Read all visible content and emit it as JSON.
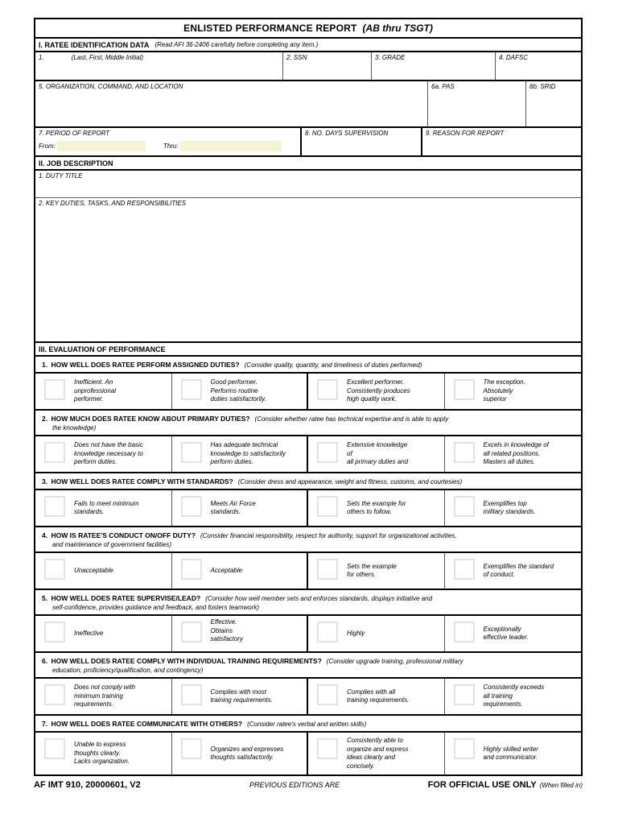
{
  "form": {
    "title_main": "ENLISTED PERFORMANCE REPORT",
    "title_sub": "(AB thru TSGT)"
  },
  "section_i": {
    "heading": "I. RATEE IDENTIFICATION DATA",
    "note": "(Read AFI 36-2406 carefully before completing any item.)",
    "fields": {
      "name_num": "1.",
      "name_label": "(Last, First, Middle Initial)",
      "ssn": "2.  SSN",
      "grade": "3.  GRADE",
      "dafsc": "4.  DAFSC",
      "organization": "5. ORGANIZATION, COMMAND, AND LOCATION",
      "pas": "6a. PAS",
      "srid": "6b. SRID",
      "period": "7.  PERIOD OF REPORT",
      "period_from": "From:",
      "period_thru": "Thru:",
      "period_from_value": "",
      "period_thru_value": "",
      "days_supervision": "8.  NO. DAYS SUPERVISION",
      "reason": "9.  REASON FOR REPORT"
    }
  },
  "section_ii": {
    "heading": "II.  JOB DESCRIPTION",
    "duty_title": "1.  DUTY TITLE",
    "key_duties": "2.  KEY DUTIES, TASKS, AND RESPONSIBILITIES"
  },
  "section_iii": {
    "heading": "III.  EVALUATION OF PERFORMANCE",
    "questions": [
      {
        "number": "1.",
        "text": "HOW WELL DOES RATEE PERFORM ASSIGNED DUTIES?",
        "hint": "(Consider quality, quantity, and timeliness of duties performed)",
        "cont": "",
        "cont_bold": "",
        "options": [
          {
            "lines": [
              "Inefficient. An",
              "unprofessional",
              "performer."
            ],
            "align": "center"
          },
          {
            "lines": [
              "Good performer.",
              "Performs routine",
              "duties satisfactorily."
            ],
            "align": "center"
          },
          {
            "lines": [
              "Excellent performer.",
              "Consistently produces",
              "high quality work."
            ],
            "align": "center"
          },
          {
            "lines": [
              "The exception.",
              "Absolutely",
              "superior"
            ],
            "align": "center"
          }
        ]
      },
      {
        "number": "2.",
        "text": "HOW MUCH DOES RATEE KNOW ABOUT PRIMARY DUTIES?",
        "hint": "(Consider whether ratee has technical expertise and is able to apply",
        "cont": "the knowledge)",
        "cont_bold": "",
        "options": [
          {
            "lines": [
              "Does not have the basic",
              "knowledge necessary to",
              "perform duties."
            ],
            "align": "center"
          },
          {
            "lines": [
              "Has adequate technical",
              "knowledge to satisfactorily",
              "perform duties."
            ],
            "align": "center"
          },
          {
            "lines": [
              "Extensive knowledge",
              "of",
              "all primary duties and"
            ],
            "align": "center"
          },
          {
            "lines": [
              "Excels in knowledge of",
              "all related positions.",
              "Masters all duties."
            ],
            "align": "center"
          }
        ]
      },
      {
        "number": "3.",
        "text": "HOW WELL DOES RATEE COMPLY WITH STANDARDS?",
        "hint": "(Consider dress and appearance, weight and fitness, customs, and courtesies)",
        "cont": "",
        "cont_bold": "",
        "options": [
          {
            "lines": [
              "Fails to meet minimum",
              "standards."
            ],
            "align": "center"
          },
          {
            "lines": [
              "Meets Air Force",
              "standards."
            ],
            "align": "center"
          },
          {
            "lines": [
              "Sets the example for",
              "others to follow."
            ],
            "align": "center"
          },
          {
            "lines": [
              "Exemplifies top",
              "military standards."
            ],
            "align": "center"
          }
        ]
      },
      {
        "number": "4.",
        "text": "HOW IS RATEE'S CONDUCT ON/OFF DUTY?",
        "hint": "(Consider financial responsibility, respect for authority, support for organizational activities,",
        "cont": "and maintenance of government facilities)",
        "cont_bold": "",
        "options": [
          {
            "lines": [
              "Unacceptable"
            ],
            "align": "center"
          },
          {
            "lines": [
              "Acceptable"
            ],
            "align": "center"
          },
          {
            "lines": [
              "Sets the example",
              "for others."
            ],
            "align": "center"
          },
          {
            "lines": [
              "Exemplifies the standard",
              "of conduct."
            ],
            "align": "center"
          }
        ]
      },
      {
        "number": "5.",
        "text": "HOW WELL DOES RATEE SUPERVISE/LEAD?",
        "hint": "(Consider how well member sets and enforces standards, displays initiative and",
        "cont": "self-confidence, provides guidance and feedback, and fosters teamwork)",
        "cont_bold": "",
        "options": [
          {
            "lines": [
              "Ineffective"
            ],
            "align": "center"
          },
          {
            "lines": [
              "Effective.",
              "Obtains",
              "satisfactory"
            ],
            "align": "top"
          },
          {
            "lines": [
              "Highly"
            ],
            "align": "center"
          },
          {
            "lines": [
              "Exceptionally",
              "effective leader."
            ],
            "align": "center"
          }
        ]
      },
      {
        "number": "6.",
        "text": "HOW WELL DOES RATEE COMPLY WITH INDIVIDUAL TRAINING REQUIREMENTS?",
        "hint": "(Consider upgrade training, professional military",
        "cont": "education, proficiency/qualification, and contingency)",
        "cont_bold": "",
        "options": [
          {
            "lines": [
              "Does not comply with",
              "minimum training",
              "requirements."
            ],
            "align": "center"
          },
          {
            "lines": [
              "Complies with most",
              "training requirements."
            ],
            "align": "center"
          },
          {
            "lines": [
              "Complies with all",
              "training requirements."
            ],
            "align": "center"
          },
          {
            "lines": [
              "Consistently exceeds",
              "all training",
              "requirements."
            ],
            "align": "center"
          }
        ]
      },
      {
        "number": "7.",
        "text": "HOW WELL DOES RATEE COMMUNICATE WITH OTHERS?",
        "hint": "(Consider ratee's verbal and written skills)",
        "cont": "",
        "cont_bold": "",
        "options": [
          {
            "lines": [
              "Unable to express",
              "thoughts clearly.",
              "Lacks organization."
            ],
            "align": "center"
          },
          {
            "lines": [
              "Organizes and expresses",
              "thoughts satisfactorily."
            ],
            "align": "center"
          },
          {
            "lines": [
              "Consistently able to",
              "organize and express",
              "ideas clearly and",
              "concisely."
            ],
            "align": "center"
          },
          {
            "lines": [
              "Highly skilled writer",
              "and communicator."
            ],
            "align": "center"
          }
        ]
      }
    ]
  },
  "footer": {
    "form_id": "AF IMT  910, 20000601, V2",
    "editions": "PREVIOUS EDITIONS ARE",
    "official": "FOR OFFICIAL USE ONLY",
    "when_filled": "(When filled in)"
  },
  "colors": {
    "highlight_field": "#f4f4d2",
    "border": "#000000",
    "checkbox_border": "#e2e2e2"
  }
}
